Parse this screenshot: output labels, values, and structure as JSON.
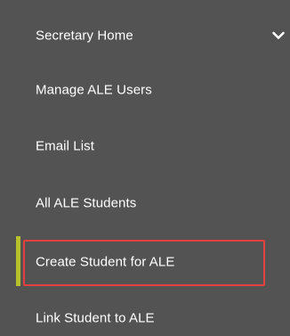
{
  "sidebar": {
    "items": [
      {
        "label": "Secretary Home",
        "has_chevron": true
      },
      {
        "label": "Manage ALE Users"
      },
      {
        "label": "Email List"
      },
      {
        "label": "All ALE Students"
      },
      {
        "label": "Create Student for ALE",
        "active": true,
        "highlighted": true
      },
      {
        "label": "Link Student to ALE"
      }
    ],
    "chevron_icon": "chevron-down-icon"
  },
  "colors": {
    "background": "#535353",
    "text": "#ffffff",
    "active_indicator": "#b7c12b",
    "highlight_border": "#e3403f"
  }
}
